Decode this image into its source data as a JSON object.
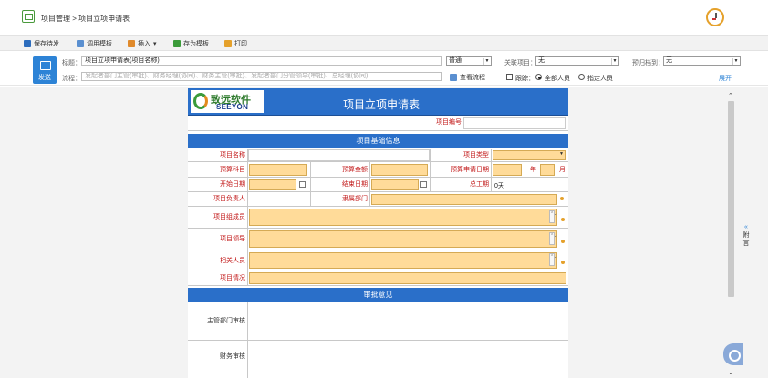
{
  "breadcrumb": "项目管理 > 项目立项申请表",
  "toolbar": {
    "save_draft": "保存待发",
    "template_call": "调用模板",
    "insert": "插入",
    "save_template": "存为模板",
    "print": "打印"
  },
  "header": {
    "send": "发送",
    "title_label": "标题：",
    "title_value": "项目立项申请表(项目名称)",
    "flow_label": "流程：",
    "flow_placeholder": "发起者部门主管(审批)、财务经理(协同)、财务主管(审批)、发起者部门分管领导(审批)、总经理(协同)",
    "importance": "普通",
    "related_label": "关联项目：",
    "related_value": "无",
    "budget_label": "预归档到：",
    "budget_value": "无",
    "view_flow": "查看流程",
    "trace_label": "跟踪：",
    "all_people": "全部人员",
    "specific_people": "指定人员",
    "expand": "展开"
  },
  "form": {
    "logo_cn": "致远软件",
    "logo_en": "SEEYON",
    "title": "项目立项申请表",
    "project_no": "项目编号",
    "basic_section": "项目基础信息",
    "name": "项目名称",
    "type": "项目类型",
    "budget_subject": "预算科目",
    "budget_amount": "预算金额",
    "budget_date": "预算申请日期",
    "year": "年",
    "month": "月",
    "start_date": "开始日期",
    "end_date": "结束日期",
    "total_days": "总工期",
    "total_days_value": "0天",
    "leader": "项目负责人",
    "department": "隶属部门",
    "members": "项目组成员",
    "lead": "项目领导",
    "related": "相关人员",
    "situation": "项目情况",
    "approval_section": "审批意见",
    "dept_review": "主管部门审核",
    "finance_review": "财务审核"
  },
  "side": {
    "collapse": "«",
    "attach": "附",
    "attach2": "言"
  }
}
